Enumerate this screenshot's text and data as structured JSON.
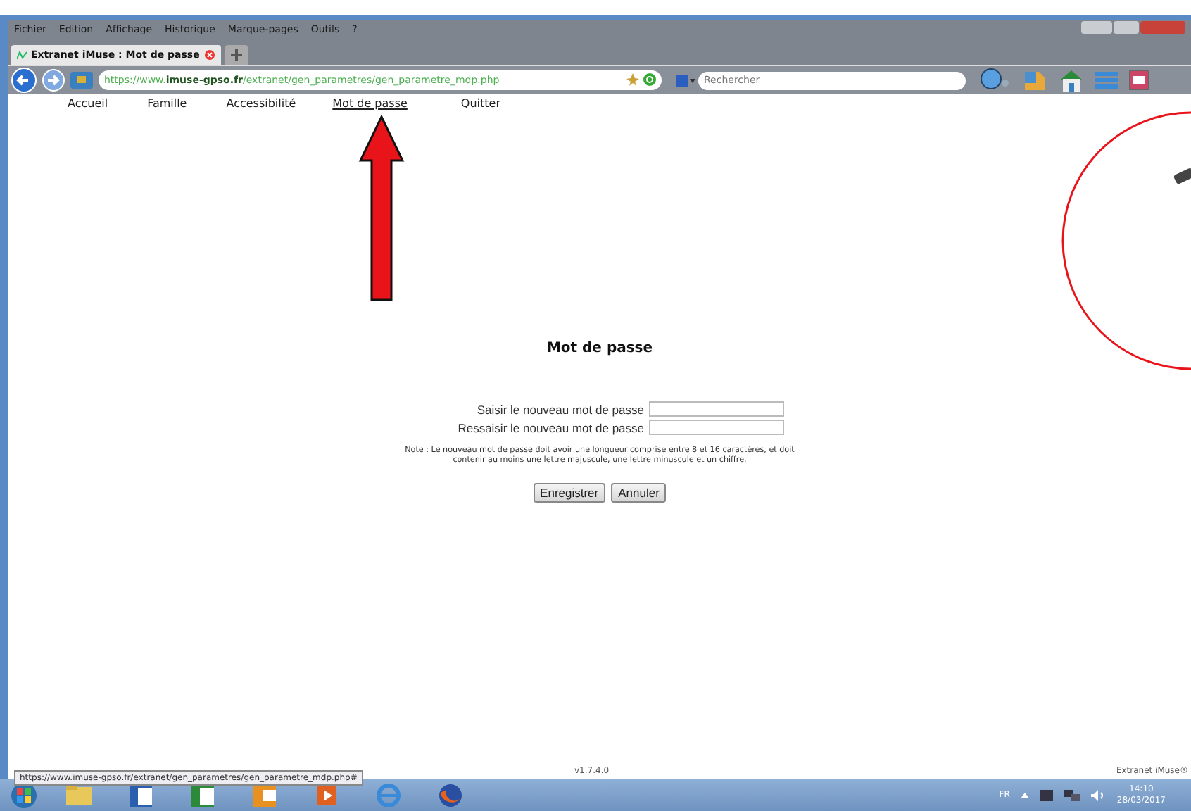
{
  "menu_bar": [
    "Fichier",
    "Edition",
    "Affichage",
    "Historique",
    "Marque-pages",
    "Outils",
    "?"
  ],
  "tab": {
    "title": "Extranet iMuse : Mot de passe",
    "selected": true
  },
  "address_bar": {
    "url": "https://www.**imuse-gpso.fr**/extranet/gen_parametres/gen_parametre_mdp.php"
  },
  "search": {
    "placeholder": "Rechercher"
  },
  "site_nav": [
    {
      "label": "Accueil",
      "selected": false
    },
    {
      "label": "Famille",
      "selected": false
    },
    {
      "label": "Accessibilité",
      "selected": false
    },
    {
      "label": "Mot de passe",
      "selected": true
    },
    {
      "label": "Quitter",
      "selected": false
    }
  ],
  "form": {
    "title": "Mot de passe",
    "fields": [
      {
        "label": "Saisir le nouveau mot de passe"
      },
      {
        "label": "Ressaisir le nouveau mot de passe"
      }
    ],
    "note": "Note : Le nouveau mot de passe doit avoir une longueur comprise entre 8 et 16 caractères, et doit contenir au moins une lettre majuscule, une lettre minuscule et un chiffre.",
    "buttons": [
      "Enregistrer",
      "Annuler"
    ]
  },
  "footer": {
    "version": "v1.7.4.0",
    "brand": "Extranet iMuse®"
  },
  "status_tooltip": "https://www.imuse-gpso.fr/extranet/gen_parametres/gen_parametre_mdp.php#",
  "taskbar": {
    "language": "FR",
    "time": "14:10",
    "date": "28/03/2017"
  }
}
